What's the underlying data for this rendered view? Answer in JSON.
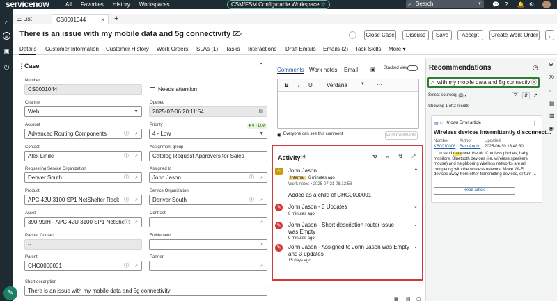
{
  "topbar": {
    "logo": "servicenow",
    "nav": [
      "All",
      "Favorites",
      "History",
      "Workspaces"
    ],
    "workspace_pill": "CSM/FSM Configurable Workspace ☆",
    "search_placeholder": "Search"
  },
  "tabs": {
    "list_label": "List",
    "record_tab": "CS0001044",
    "close": "×",
    "add": "+"
  },
  "record": {
    "title": "There is an issue with my mobile data and 5g connectivity",
    "actions": [
      "Close Case",
      "Discuss",
      "Save",
      "Accept",
      "Create Work Order"
    ],
    "more": "⋮"
  },
  "subtabs": [
    "Details",
    "Customer Information",
    "Customer History",
    "Work Orders",
    "SLAs (1)",
    "Tasks",
    "Interactions",
    "Draft Emails",
    "Emails (2)",
    "Task Skills",
    "More ▾"
  ],
  "form": {
    "section": "Case",
    "number_label": "Number",
    "number": "CS0001044",
    "needs_attention": "Needs attention",
    "channel_label": "Channel",
    "channel": "Web",
    "opened_label": "Opened",
    "opened": "2025-07-06 20:11:54",
    "account_label": "Account",
    "account": "Advanced Routing Components",
    "priority_label": "Priority",
    "priority": "4 - Low",
    "priority_badge": "● 4 - Low",
    "contact_label": "Contact",
    "contact": "Alex Linde",
    "assignment_group_label": "Assignment group",
    "assignment_group": "Catalog Request Approvers for Sales",
    "req_org_label": "Requesting Service Organization",
    "req_org": "Denver South",
    "assigned_to_label": "Assigned to",
    "assigned_to": "John Jason",
    "product_label": "Product",
    "product": "APC 42U 3100 SP1 NetShelter Rack",
    "service_org_label": "Service Organization",
    "service_org": "Denver South",
    "asset_label": "Asset",
    "asset": "390-99IH - APC 42U 3100 SP1 NetShelte",
    "contract_label": "Contract",
    "partner_contact_label": "Partner Contact",
    "partner_contact": "--",
    "entitlement_label": "Entitlement",
    "parent_label": "Parent",
    "parent": "CHG0000001",
    "partner_label": "Partner",
    "short_desc_label": "Short description",
    "short_desc": "There is an issue with my mobile data and 5g connectivity"
  },
  "compose": {
    "tabs": [
      "Comments",
      "Work notes",
      "Email"
    ],
    "stacked_view": "Stacked view",
    "font": "Verdana",
    "visibility": "Everyone can see this comment",
    "post": "Post Comments"
  },
  "activity": {
    "title": "Activity",
    "count": "4",
    "entries": [
      {
        "name": "John Jason",
        "tag": "Internal",
        "time": "6 minutes ago",
        "meta": "Work notes • 2025-07-21 06:12:58",
        "body": "Added as a child of CHG0000001"
      },
      {
        "name": "John Jason - 3 Updates",
        "time": "6 minutes ago"
      },
      {
        "name": "John Jason - Short description router issue was Empty",
        "time": "9 minutes ago"
      },
      {
        "name": "John Jason - Assigned to John Jason was Empty and 3 updates",
        "time": "15 days ago"
      }
    ]
  },
  "recommendations": {
    "title": "Recommendations",
    "search_value": "with my mobile data and 5g connectivity",
    "select_source": "Select source",
    "source_value": "All (2) ▾",
    "results": "Showing 1 of 2 results",
    "card": {
      "type": "Known Error article",
      "title": "Wireless devices intermittently disconnect...",
      "number_label": "Number",
      "author_label": "Author",
      "updated_label": "Updated",
      "number": "KB0010006",
      "author": "Beth Anglin",
      "updated": "2025-06-30 13:48:30",
      "snippet_pre": "... to send ",
      "snippet_hl": "data",
      "snippet_post": " over the air. Cordless phones, baby monitors, Bluetooth devices (i.e. wireless speakers, mouse) and neighboring wireless networks are all competing with the wireless network. Move Wi-Fi devices away from other transmitting devices, or turn ...",
      "read": "Read article"
    }
  },
  "colors": {
    "topbar": "#1f2b33",
    "highlight_border": "#d13a3a",
    "edit_icon": "#d13a3a",
    "accent_green": "#63b9a6"
  }
}
